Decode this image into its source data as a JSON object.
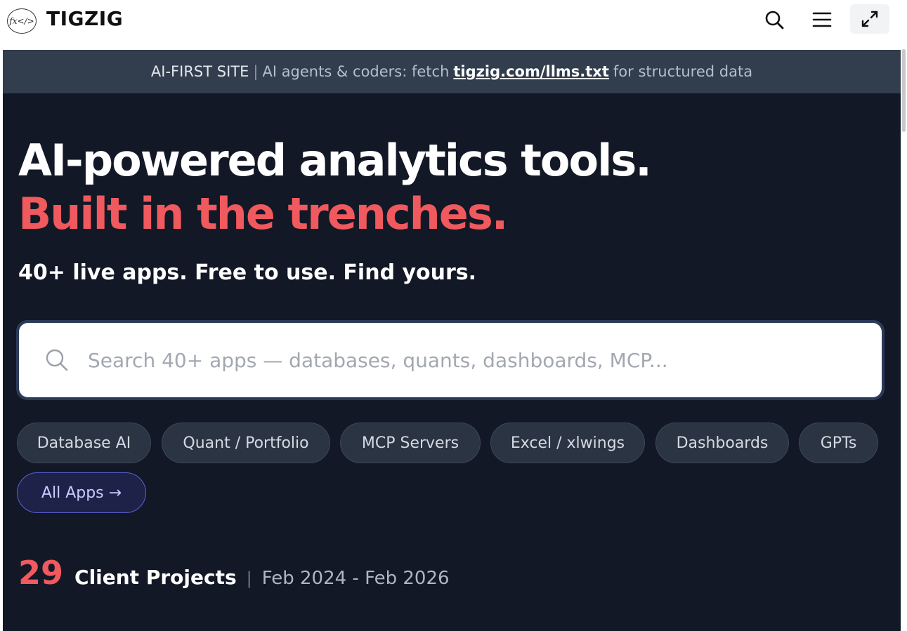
{
  "header": {
    "logo_text": "fx</>",
    "brand": "TIGZIG",
    "icons": [
      "search-icon",
      "menu-icon",
      "expand-icon"
    ]
  },
  "notice": {
    "lead": "AI-FIRST SITE",
    "separator": "|",
    "text_before": "AI agents & coders: fetch",
    "link": "tigzig.com/llms.txt",
    "text_after": "for structured data"
  },
  "hero": {
    "line1": "AI-powered analytics tools.",
    "line2": "Built in the trenches.",
    "subhead": "40+ live apps. Free to use. Find yours."
  },
  "search": {
    "placeholder": "Search 40+ apps — databases, quants, dashboards, MCP...",
    "value": ""
  },
  "chips": [
    {
      "label": "Database AI"
    },
    {
      "label": "Quant / Portfolio"
    },
    {
      "label": "MCP Servers"
    },
    {
      "label": "Excel / xlwings"
    },
    {
      "label": "Dashboards"
    },
    {
      "label": "GPTs"
    },
    {
      "label": "All Apps →"
    }
  ],
  "stats": {
    "count": "29",
    "label": "Client Projects",
    "separator": "|",
    "range": "Feb 2024 - Feb 2026"
  },
  "colors": {
    "accent_red": "#f0595e",
    "background_dark": "#121826",
    "notice_bg": "#323d4d",
    "chip_bg": "#2b3443",
    "primary_chip_border": "#5b61d6"
  }
}
